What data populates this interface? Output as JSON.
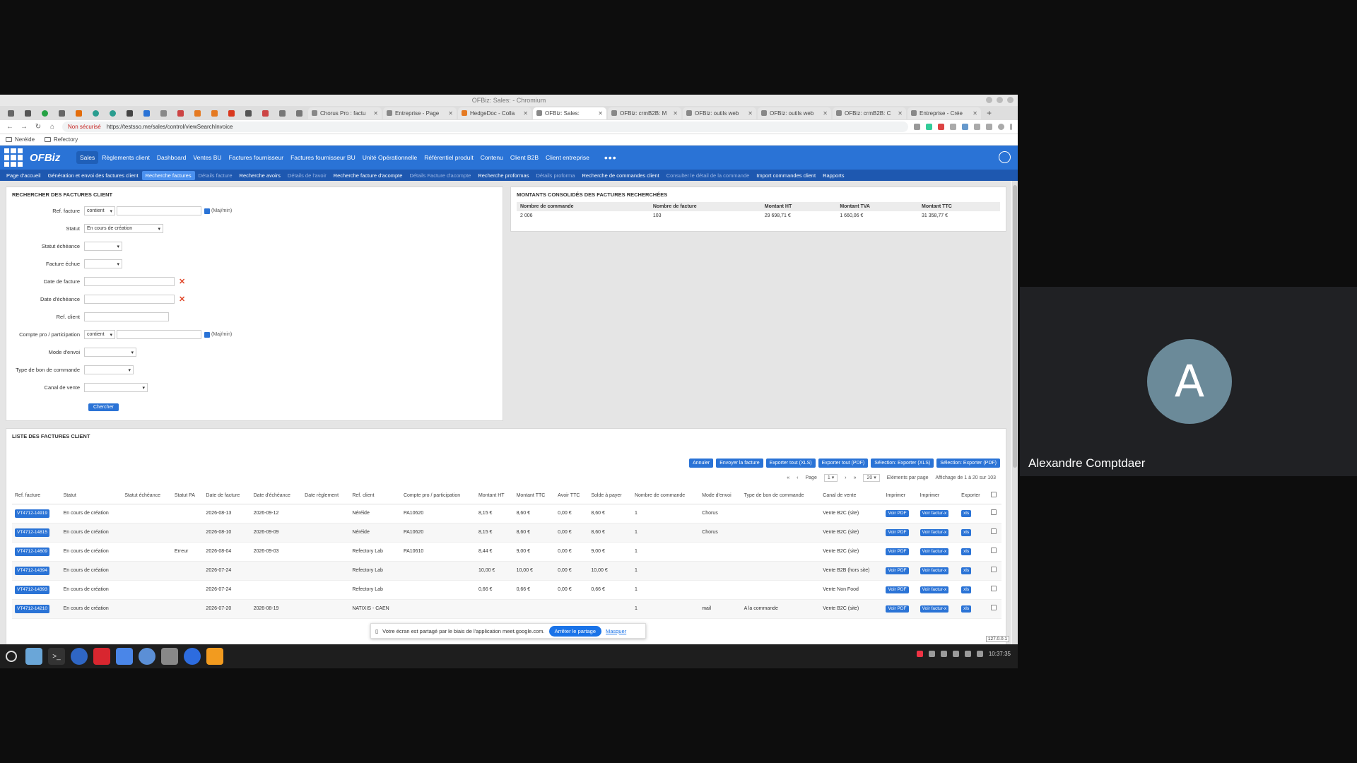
{
  "browser": {
    "window_title": "OFBiz: Sales: - Chromium",
    "tabs": [
      {
        "label": "Chorus Pro : factu",
        "active": false
      },
      {
        "label": "Entreprise - Page",
        "active": false
      },
      {
        "label": "HedgeDoc - Colla",
        "active": false
      },
      {
        "label": "OFBiz: Sales:",
        "active": true
      },
      {
        "label": "OFBiz: crmB2B: M",
        "active": false
      },
      {
        "label": "OFBiz: outils web",
        "active": false
      },
      {
        "label": "OFBiz: outils web",
        "active": false
      },
      {
        "label": "OFBiz: crmB2B: C",
        "active": false
      },
      {
        "label": "Entreprise - Crée",
        "active": false
      }
    ],
    "new_tab": "+",
    "security_label": "Non sécurisé",
    "url": "https://testsso.me/sales/control/viewSearchInvoice",
    "bookmarks": [
      "Neréide",
      "Refectory"
    ]
  },
  "app": {
    "logo_text": "OFBiz",
    "main_nav": [
      {
        "label": "Sales",
        "active": true
      },
      {
        "label": "Règlements client"
      },
      {
        "label": "Dashboard"
      },
      {
        "label": "Ventes BU"
      },
      {
        "label": "Factures fournisseur"
      },
      {
        "label": "Factures fournisseur BU"
      },
      {
        "label": "Unité Opérationnelle"
      },
      {
        "label": "Référentiel produit"
      },
      {
        "label": "Contenu"
      },
      {
        "label": "Client B2B"
      },
      {
        "label": "Client entreprise"
      }
    ],
    "more": "•••",
    "sub_nav": [
      {
        "label": "Page d'accueil",
        "state": "normal"
      },
      {
        "label": "Génération et envoi des factures client",
        "state": "normal"
      },
      {
        "label": "Recherche factures",
        "state": "active"
      },
      {
        "label": "Détails facture",
        "state": "dim"
      },
      {
        "label": "Recherche avoirs",
        "state": "normal"
      },
      {
        "label": "Détails de l'avoir",
        "state": "dim"
      },
      {
        "label": "Recherche facture d'acompte",
        "state": "normal"
      },
      {
        "label": "Détails Facture d'acompte",
        "state": "dim"
      },
      {
        "label": "Recherche proformas",
        "state": "normal"
      },
      {
        "label": "Détails proforma",
        "state": "dim"
      },
      {
        "label": "Recherche de commandes client",
        "state": "normal"
      },
      {
        "label": "Consulter le détail de la commande",
        "state": "dim"
      },
      {
        "label": "Import commandes client",
        "state": "normal"
      },
      {
        "label": "Rapports",
        "state": "normal"
      }
    ]
  },
  "search": {
    "title": "RECHERCHER DES FACTURES CLIENT",
    "fields": {
      "ref_facture": {
        "label": "Ref. facture",
        "op": "contient",
        "ignore_case": "(Maj/min)"
      },
      "statut": {
        "label": "Statut",
        "value": "En cours de création"
      },
      "statut_echeance": {
        "label": "Statut échéance"
      },
      "facture_echue": {
        "label": "Facture échue"
      },
      "date_facture": {
        "label": "Date de facture"
      },
      "date_echeance": {
        "label": "Date d'échéance"
      },
      "ref_client": {
        "label": "Ref. client"
      },
      "compte": {
        "label": "Compte pro / participation",
        "op": "contient",
        "ignore_case": "(Maj/min)"
      },
      "mode_envoi": {
        "label": "Mode d'envoi"
      },
      "type_bon": {
        "label": "Type de bon de commande"
      },
      "canal": {
        "label": "Canal de vente"
      }
    },
    "clear_icon": "✕",
    "submit": "Chercher"
  },
  "summary": {
    "title": "MONTANTS CONSOLIDÉS DES FACTURES RECHERCHÉES",
    "headers": [
      "Nombre de commande",
      "Nombre de facture",
      "Montant HT",
      "Montant TVA",
      "Montant TTC"
    ],
    "row": [
      "2 006",
      "103",
      "29 698,71 €",
      "1 660,06 €",
      "31 358,77 €"
    ]
  },
  "list": {
    "title": "LISTE DES FACTURES CLIENT",
    "actions": [
      "Annuler",
      "Envoyer la facture",
      "Exporter tout (XLS)",
      "Exporter tout (PDF)",
      "Sélection: Exporter (XLS)",
      "Sélection: Exporter (PDF)"
    ],
    "pager": {
      "page_label": "Page",
      "page": "1",
      "per_page": "20",
      "per_page_label": "Eléments par page",
      "display": "Affichage de 1 à 20 sur 103"
    },
    "headers": [
      "Ref. facture",
      "Statut",
      "Statut échéance",
      "Statut PA",
      "Date de facture",
      "Date d'échéance",
      "Date règlement",
      "Ref. client",
      "Compte pro / participation",
      "Montant HT",
      "Montant TTC",
      "Avoir TTC",
      "Solde à payer",
      "Nombre de commande",
      "Mode d'envoi",
      "Type de bon de commande",
      "Canal de vente",
      "Imprimer",
      "Imprimer",
      "Exporter"
    ],
    "rows": [
      [
        "VT4712-14919",
        "En cours de création",
        "",
        "",
        "2026-08-13",
        "2026-09-12",
        "",
        "Néréide",
        "PA10620",
        "8,15 €",
        "8,60 €",
        "0,00 €",
        "8,60 €",
        "1",
        "Chorus",
        "",
        "Vente B2C (site)"
      ],
      [
        "VT4712-14815",
        "En cours de création",
        "",
        "",
        "2026-08-10",
        "2026-09-09",
        "",
        "Néréide",
        "PA10620",
        "8,15 €",
        "8,60 €",
        "0,00 €",
        "8,60 €",
        "1",
        "Chorus",
        "",
        "Vente B2C (site)"
      ],
      [
        "VT4712-14609",
        "En cours de création",
        "",
        "Erreur",
        "2026-08-04",
        "2026-09-03",
        "",
        "Refectory Lab",
        "PA10610",
        "8,44 €",
        "9,00 €",
        "0,00 €",
        "9,00 €",
        "1",
        "",
        "",
        "Vente B2C (site)"
      ],
      [
        "VT4712-14394",
        "En cours de création",
        "",
        "",
        "2026-07-24",
        "",
        "",
        "Refectory Lab",
        "",
        "10,00 €",
        "10,00 €",
        "0,00 €",
        "10,00 €",
        "1",
        "",
        "",
        "Vente B2B (hors site)"
      ],
      [
        "VT4712-14393",
        "En cours de création",
        "",
        "",
        "2026-07-24",
        "",
        "",
        "Refectory Lab",
        "",
        "0,66 €",
        "0,66 €",
        "0,00 €",
        "0,66 €",
        "1",
        "",
        "",
        "Vente Non Food"
      ],
      [
        "VT4712-14210",
        "En cours de création",
        "",
        "",
        "2026-07-20",
        "2026-08-19",
        "",
        "NATIXIS - CAEN",
        "",
        "",
        "",
        "",
        "",
        "1",
        "mail",
        "A la commande",
        "Vente B2C (site)"
      ]
    ],
    "pdf_label": "Voir PDF",
    "facturx_label": "Voir factur-x",
    "xls_label": "xls"
  },
  "share_bar": {
    "text": "Votre écran est partagé par le biais de l'application meet.google.com.",
    "stop": "Arrêter le partage",
    "hide": "Masquer"
  },
  "tooltip": "127.0.0.1",
  "taskbar": {
    "clock": "10:37:35"
  },
  "meet": {
    "avatar_letter": "A",
    "participant": "Alexandre Comptdaer"
  }
}
